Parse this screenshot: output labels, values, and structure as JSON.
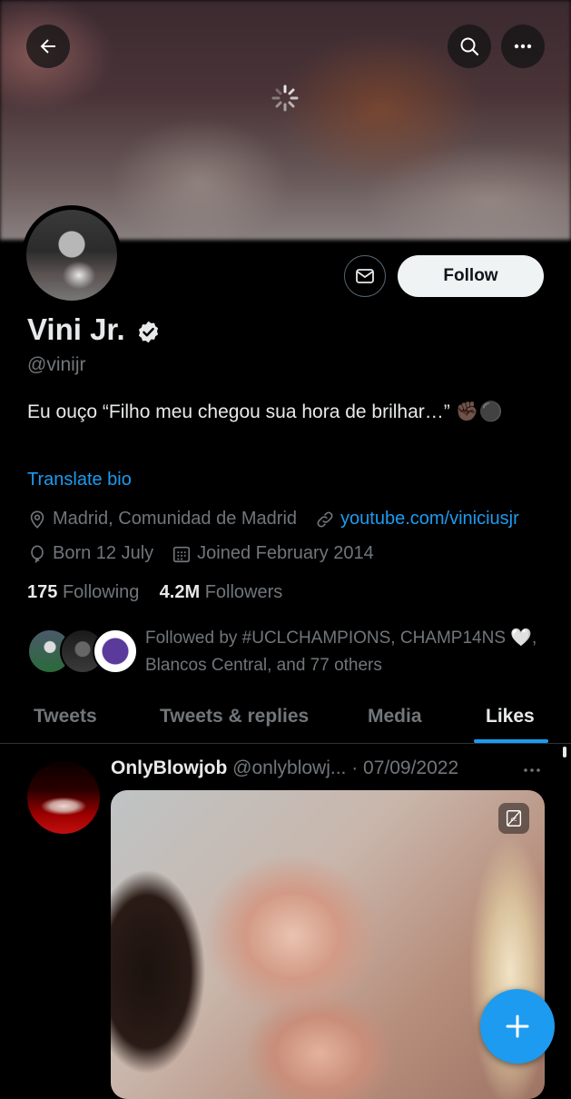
{
  "profile": {
    "name": "Vini Jr.",
    "handle": "@vinijr",
    "bio": "Eu ouço “Filho meu chegou sua hora de brilhar…” ✊🏿⚫️",
    "translate_label": "Translate bio",
    "location": "Madrid, Comunidad de Madrid",
    "website": "youtube.com/viniciusjr",
    "born": "Born 12 July",
    "joined": "Joined February 2014",
    "following_count": "175",
    "following_label": "Following",
    "followers_count": "4.2M",
    "followers_label": "Followers",
    "followed_by": "Followed by #UCLCHAMPIONS, CHAMP14NS 🤍, Blancos Central, and 77 others"
  },
  "actions": {
    "follow_label": "Follow"
  },
  "tabs": [
    {
      "label": "Tweets"
    },
    {
      "label": "Tweets & replies"
    },
    {
      "label": "Media"
    },
    {
      "label": "Likes"
    }
  ],
  "active_tab": "Likes",
  "tweet": {
    "author": "OnlyBlowjob",
    "handle": "@onlyblowj...",
    "date": "· 07/09/2022"
  },
  "icons": {
    "back": "arrow-left-icon",
    "search": "search-icon",
    "more": "more-icon",
    "mail": "mail-icon",
    "verified": "verified-icon",
    "location": "location-icon",
    "link": "link-icon",
    "born": "balloon-icon",
    "calendar": "calendar-icon",
    "compose": "plus-icon"
  },
  "colors": {
    "accent": "#1d9bf0",
    "background": "#000000",
    "secondary_text": "#71767b"
  }
}
